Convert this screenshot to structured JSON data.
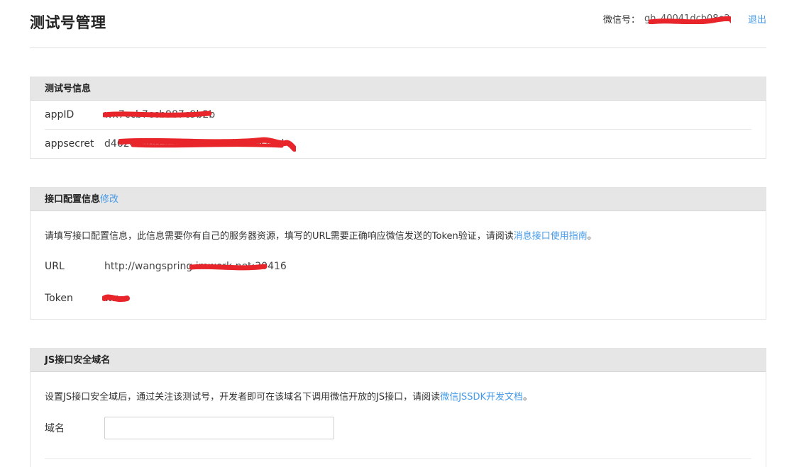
{
  "header": {
    "title": "测试号管理",
    "account_label": "微信号：",
    "account_value": "gh_40041dcb08e2",
    "logout_label": "退出"
  },
  "test_account": {
    "title": "测试号信息",
    "appid_label": "appID",
    "appid_value": "wx7ccb7ccb987c9b2b",
    "appsecret_label": "appsecret",
    "appsecret_value": "d4624c36b3c7a0f7e8a12b9f0dcc4d"
  },
  "interface_config": {
    "title": "接口配置信息",
    "edit_label": "修改",
    "desc_text": "请填写接口配置信息，此信息需要你有自己的服务器资源，填写的URL需要正确响应微信发送的Token验证，请阅读",
    "desc_link": "消息接口使用指南",
    "desc_end": "。",
    "url_label": "URL",
    "url_value": "http://wangspring.imwork.net:30416",
    "token_label": "Token",
    "token_value": "wx"
  },
  "js_domain": {
    "title": "JS接口安全域名",
    "desc_text": "设置JS接口安全域后，通过关注该测试号，开发者即可在该域名下调用微信开放的JS接口，请阅读",
    "desc_link": "微信JSSDK开发文档",
    "desc_end": "。",
    "domain_label": "域名",
    "domain_value": ""
  },
  "colors": {
    "link": "#459ae9",
    "redaction": "#e8252b",
    "panel_header_bg": "#e6e6e6"
  }
}
